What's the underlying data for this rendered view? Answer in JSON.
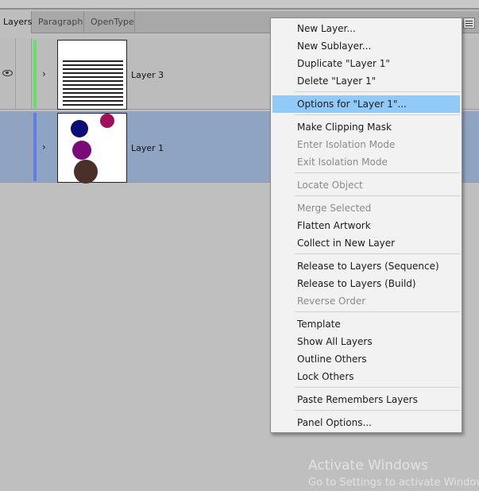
{
  "tabs": [
    {
      "label": "Layers",
      "active": true
    },
    {
      "label": "Paragraph",
      "active": false
    },
    {
      "label": "OpenType",
      "active": false
    }
  ],
  "layers": [
    {
      "name": "Layer 3",
      "color": "#62e262",
      "visible": true,
      "thumbnail": "text"
    },
    {
      "name": "Layer 1",
      "color": "#5b7fe6",
      "visible": false,
      "selected": true,
      "thumbnail": "circles"
    }
  ],
  "thumbnail_circle_colors": [
    "#0d0d7a",
    "#a0105a",
    "#7a0a7a",
    "#4a3028"
  ],
  "menu": {
    "items": [
      {
        "label": "New Layer...",
        "enabled": true
      },
      {
        "label": "New Sublayer...",
        "enabled": true
      },
      {
        "label": "Duplicate \"Layer 1\"",
        "enabled": true
      },
      {
        "label": "Delete \"Layer 1\"",
        "enabled": true
      },
      {
        "label": "Options for \"Layer 1\"...",
        "enabled": true,
        "highlighted": true
      },
      {
        "label": "Make Clipping Mask",
        "enabled": true
      },
      {
        "label": "Enter Isolation Mode",
        "enabled": false
      },
      {
        "label": "Exit Isolation Mode",
        "enabled": false
      },
      {
        "label": "Locate Object",
        "enabled": false
      },
      {
        "label": "Merge Selected",
        "enabled": false
      },
      {
        "label": "Flatten Artwork",
        "enabled": true
      },
      {
        "label": "Collect in New Layer",
        "enabled": true
      },
      {
        "label": "Release to Layers (Sequence)",
        "enabled": true
      },
      {
        "label": "Release to Layers (Build)",
        "enabled": true
      },
      {
        "label": "Reverse Order",
        "enabled": false
      },
      {
        "label": "Template",
        "enabled": true
      },
      {
        "label": "Show All Layers",
        "enabled": true
      },
      {
        "label": "Outline Others",
        "enabled": true
      },
      {
        "label": "Lock Others",
        "enabled": true
      },
      {
        "label": "Paste Remembers Layers",
        "enabled": true
      },
      {
        "label": "Panel Options...",
        "enabled": true
      }
    ]
  },
  "watermark": {
    "line1": "Activate Windows",
    "line2": "Go to Settings to activate Windows."
  }
}
